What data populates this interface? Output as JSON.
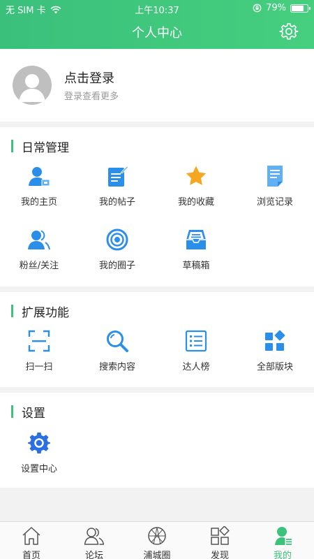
{
  "status_bar": {
    "carrier": "无 SIM 卡",
    "time": "上午10:37",
    "battery": "79%",
    "battery_level": 0.79
  },
  "header": {
    "title": "个人中心"
  },
  "profile": {
    "title": "点击登录",
    "subtitle": "登录查看更多"
  },
  "sections": [
    {
      "title": "日常管理",
      "items": [
        {
          "label": "我的主页",
          "icon": "user-home-icon"
        },
        {
          "label": "我的帖子",
          "icon": "post-icon"
        },
        {
          "label": "我的收藏",
          "icon": "star-icon"
        },
        {
          "label": "浏览记录",
          "icon": "history-icon"
        },
        {
          "label": "粉丝/关注",
          "icon": "followers-icon"
        },
        {
          "label": "我的圈子",
          "icon": "circle-icon"
        },
        {
          "label": "草稿箱",
          "icon": "drafts-icon"
        }
      ]
    },
    {
      "title": "扩展功能",
      "items": [
        {
          "label": "扫一扫",
          "icon": "scan-icon"
        },
        {
          "label": "搜索内容",
          "icon": "search-icon"
        },
        {
          "label": "达人榜",
          "icon": "ranking-list-icon"
        },
        {
          "label": "全部版块",
          "icon": "all-sections-icon"
        }
      ]
    },
    {
      "title": "设置",
      "items": [
        {
          "label": "设置中心",
          "icon": "settings-icon"
        }
      ]
    }
  ],
  "tabbar": {
    "items": [
      {
        "label": "首页",
        "icon": "home-icon"
      },
      {
        "label": "论坛",
        "icon": "forum-icon"
      },
      {
        "label": "浦城圈",
        "icon": "pucheng-circle-icon"
      },
      {
        "label": "发现",
        "icon": "discover-icon"
      },
      {
        "label": "我的",
        "icon": "me-icon",
        "active": true
      }
    ]
  },
  "colors": {
    "accent": "#3cc27c",
    "icon_blue": "#2b8fe9",
    "star": "#f5a623"
  }
}
